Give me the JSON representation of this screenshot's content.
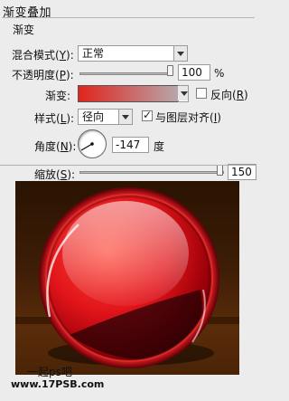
{
  "panel": {
    "title": "渐变叠加",
    "group": "渐变",
    "blend_mode": {
      "label": "混合模式(",
      "key": "Y",
      "suffix": "):",
      "value": "正常"
    },
    "opacity": {
      "label": "不透明度(",
      "key": "P",
      "suffix": "):",
      "value": "100",
      "unit": "%",
      "level": 100
    },
    "gradient": {
      "label": "渐变:",
      "reverse_label": "反向(",
      "reverse_key": "R",
      "reverse_suffix": ")",
      "reverse_checked": false
    },
    "style": {
      "label": "样式(",
      "key": "L",
      "suffix": "):",
      "value": "径向",
      "align_label": "与图层对齐(",
      "align_key": "I",
      "align_suffix": ")",
      "align_checked": true
    },
    "angle": {
      "label": "角度(",
      "key": "N",
      "suffix": "):",
      "value": "-147",
      "unit": "度"
    },
    "scale": {
      "label": "缩放(",
      "key": "S",
      "suffix": "):",
      "value": "150",
      "unit": "%",
      "level": 150
    }
  },
  "colors": {
    "panel_bg": "#ececec",
    "gradient_start": "#e0241c",
    "gradient_end": "#b7a6aa",
    "ball_red": "#e1141a",
    "preview_bg": "#3a1b04"
  },
  "watermark": {
    "text": "一起ps吧 www.17PSB.com"
  }
}
